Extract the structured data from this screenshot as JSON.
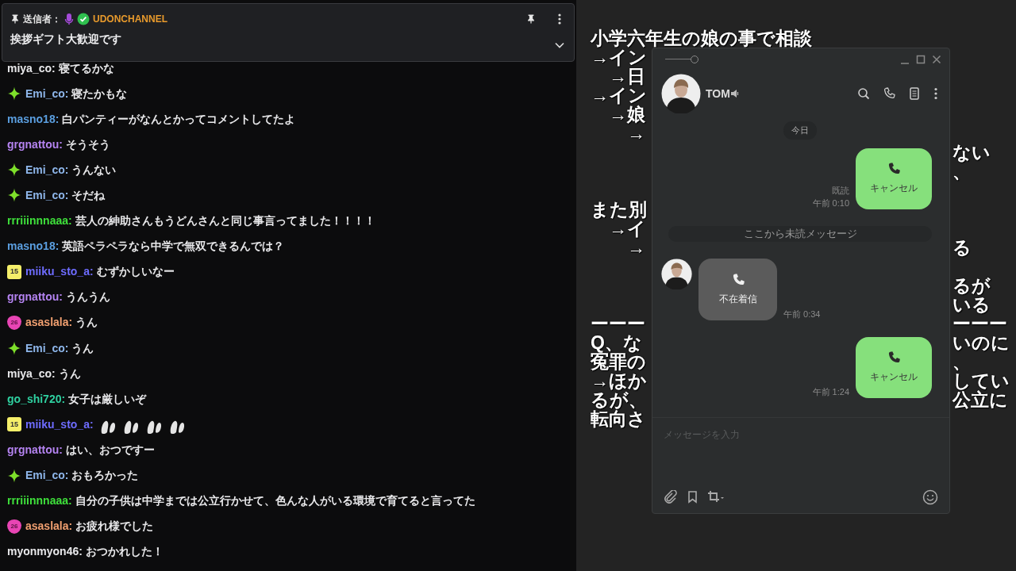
{
  "chat": {
    "pinned": {
      "label": "送信者：",
      "sender": "UDONCHANNEL",
      "message": "挨拶ギフト大歓迎です"
    },
    "messages": [
      {
        "user": "miya_co:",
        "color": "#e8e8ea",
        "text": "寝てるかな"
      },
      {
        "user": "Emi_co:",
        "color": "#8eb6ea",
        "badge": {
          "kind": "sparkle"
        },
        "text": "寝たかもな"
      },
      {
        "user": "masno18:",
        "color": "#5b9fe0",
        "text": "白パンティーがなんとかってコメントしてたよ"
      },
      {
        "user": "grgnattou:",
        "color": "#b483f0",
        "text": "そうそう"
      },
      {
        "user": "Emi_co:",
        "color": "#8eb6ea",
        "badge": {
          "kind": "sparkle"
        },
        "text": "うんない"
      },
      {
        "user": "Emi_co:",
        "color": "#8eb6ea",
        "badge": {
          "kind": "sparkle"
        },
        "text": "そだね"
      },
      {
        "user": "rrriiinnnaaa:",
        "color": "#3fe03b",
        "text": "芸人の紳助さんもうどんさんと同じ事言ってました！！！！"
      },
      {
        "user": "masno18:",
        "color": "#5b9fe0",
        "text": "英語ペラペラなら中学で無双できるんでは？"
      },
      {
        "user": "miiku_sto_a:",
        "color": "#6e6cff",
        "badge": {
          "kind": "sub",
          "text": "15"
        },
        "text": "むずかしいなー"
      },
      {
        "user": "grgnattou:",
        "color": "#b483f0",
        "text": "うんうん"
      },
      {
        "user": "asaslala:",
        "color": "#f2a070",
        "badge": {
          "kind": "drop",
          "text": "26"
        },
        "text": "うん"
      },
      {
        "user": "Emi_co:",
        "color": "#8eb6ea",
        "badge": {
          "kind": "sparkle"
        },
        "text": "うん"
      },
      {
        "user": "miya_co:",
        "color": "#e8e8ea",
        "text": "うん"
      },
      {
        "user": "go_shi720:",
        "color": "#2fd0a0",
        "text": "女子は厳しいぞ"
      },
      {
        "user": "miiku_sto_a:",
        "color": "#6e6cff",
        "badge": {
          "kind": "sub",
          "text": "15"
        },
        "emotes": [
          {
            "kind": "emote"
          },
          {
            "kind": "emote"
          },
          {
            "kind": "emote"
          },
          {
            "kind": "emote"
          }
        ]
      },
      {
        "user": "grgnattou:",
        "color": "#b483f0",
        "text": "はい、おつですー"
      },
      {
        "user": "Emi_co:",
        "color": "#8eb6ea",
        "badge": {
          "kind": "sparkle"
        },
        "text": "おもろかった"
      },
      {
        "user": "rrriiinnnaaa:",
        "color": "#3fe03b",
        "text": "自分の子供は中学までは公立行かせて、色んな人がいる環境で育てると言ってた"
      },
      {
        "user": "asaslala:",
        "color": "#f2a070",
        "badge": {
          "kind": "drop",
          "text": "26"
        },
        "text": "お疲れ様でした"
      },
      {
        "user": "myonmyon46:",
        "color": "#e8e8ea",
        "text": "おつかれした！"
      }
    ]
  },
  "board": {
    "blocks": [
      {
        "lines": [
          {
            "left": "小学六年生の娘の事で相談"
          },
          {
            "left": "→イン"
          },
          {
            "left": "　→日"
          },
          {
            "left": "→イン"
          },
          {
            "left": "　→娘"
          },
          {
            "left": "　　→"
          },
          {
            "right": "ない"
          },
          {
            "right": "、"
          }
        ]
      },
      {
        "lines": [
          {
            "left": "また別"
          },
          {
            "left": "　→イ"
          },
          {
            "left": "　　→",
            "right": "る"
          }
        ]
      },
      {
        "lines": [
          {
            "right": "るが"
          },
          {
            "right": "いる"
          },
          {
            "left": "ーーー",
            "right": "ーーー"
          },
          {
            "left": "Q、な",
            "right": "いのに"
          },
          {
            "left": "冤罪の",
            "right": "、"
          },
          {
            "left": "→ほか",
            "right": "してい"
          },
          {
            "left": "るが、",
            "right": "公立に"
          },
          {
            "left": "転向さ"
          }
        ]
      }
    ]
  },
  "line_window": {
    "opacity": {
      "level": 1
    },
    "contact": "TOM",
    "date": "今日",
    "messages": [
      {
        "kind": "sent_call",
        "label": "キャンセル",
        "read": "既読",
        "time": "午前 0:10"
      },
      {
        "kind": "divider",
        "text": "ここから未読メッセージ"
      },
      {
        "kind": "received_call",
        "label": "不在着信",
        "time": "午前 0:34"
      },
      {
        "kind": "sent_call",
        "label": "キャンセル",
        "time": "午前 1:24"
      }
    ],
    "input": {
      "placeholder": "メッセージを入力"
    }
  }
}
